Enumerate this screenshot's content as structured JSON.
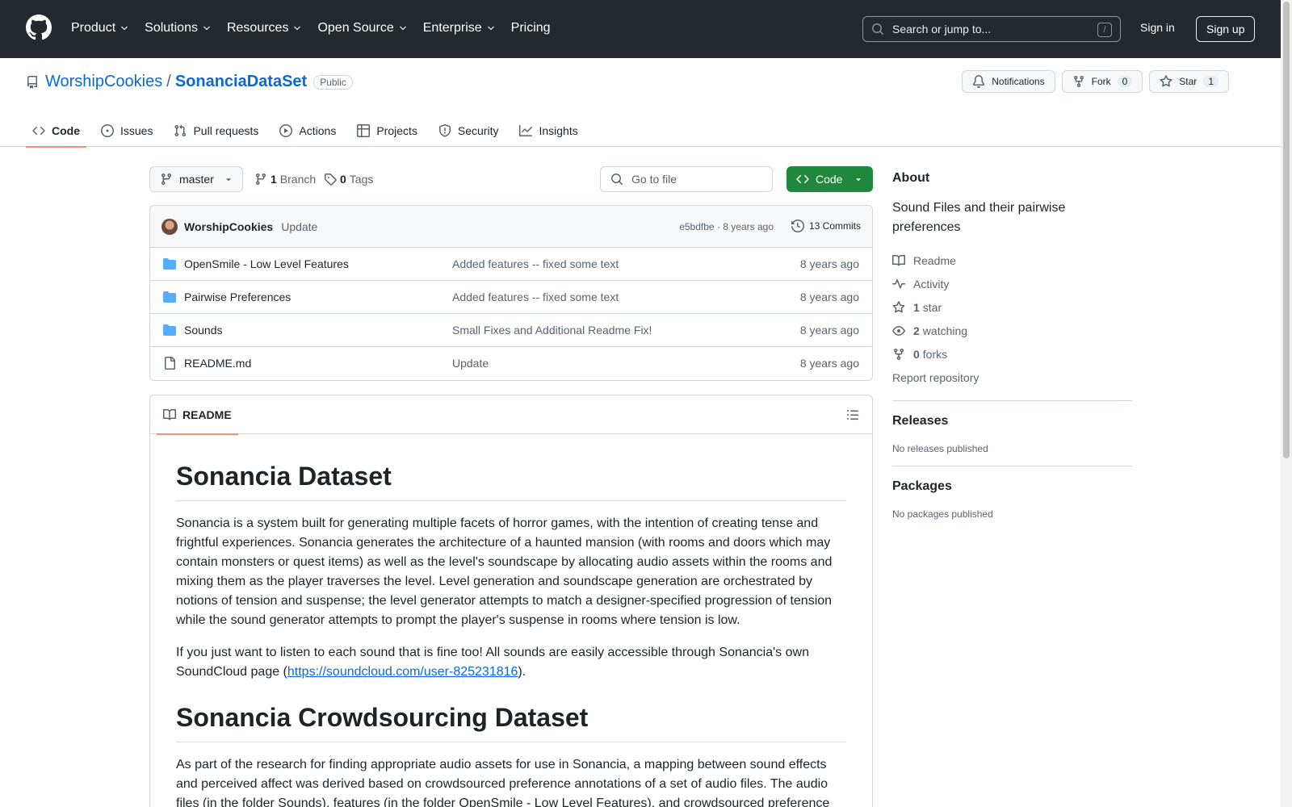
{
  "header": {
    "nav": [
      {
        "label": "Product",
        "has_menu": true
      },
      {
        "label": "Solutions",
        "has_menu": true
      },
      {
        "label": "Resources",
        "has_menu": true
      },
      {
        "label": "Open Source",
        "has_menu": true
      },
      {
        "label": "Enterprise",
        "has_menu": true
      },
      {
        "label": "Pricing",
        "has_menu": false
      }
    ],
    "search_placeholder": "Search or jump to...",
    "search_shortcut": "/",
    "sign_in": "Sign in",
    "sign_up": "Sign up"
  },
  "repo": {
    "owner": "WorshipCookies",
    "separator": "/",
    "name": "SonanciaDataSet",
    "visibility": "Public",
    "actions": {
      "notifications": "Notifications",
      "fork": "Fork",
      "fork_count": "0",
      "star": "Star",
      "star_count": "1"
    },
    "tabs": [
      {
        "label": "Code",
        "icon": "code-icon",
        "active": true
      },
      {
        "label": "Issues",
        "icon": "issue-icon",
        "active": false
      },
      {
        "label": "Pull requests",
        "icon": "pull-request-icon",
        "active": false
      },
      {
        "label": "Actions",
        "icon": "play-icon",
        "active": false
      },
      {
        "label": "Projects",
        "icon": "table-icon",
        "active": false
      },
      {
        "label": "Security",
        "icon": "shield-icon",
        "active": false
      },
      {
        "label": "Insights",
        "icon": "graph-icon",
        "active": false
      }
    ]
  },
  "toolbar": {
    "branch": "master",
    "branch_count": "1",
    "branch_label": "Branch",
    "tag_count": "0",
    "tag_label": "Tags",
    "goto_placeholder": "Go to file",
    "code_button": "Code"
  },
  "latest_commit": {
    "author": "WorshipCookies",
    "message": "Update",
    "sha": "e5bdfbe",
    "dot": "·",
    "age": "8 years ago",
    "commits": "13 Commits"
  },
  "files": [
    {
      "type": "folder",
      "name": "OpenSmile - Low Level Features",
      "message": "Added features -- fixed some text",
      "age": "8 years ago"
    },
    {
      "type": "folder",
      "name": "Pairwise Preferences",
      "message": "Added features -- fixed some text",
      "age": "8 years ago"
    },
    {
      "type": "folder",
      "name": "Sounds",
      "message": "Small Fixes and Additional Readme Fix!",
      "age": "8 years ago"
    },
    {
      "type": "file",
      "name": "README.md",
      "message": "Update",
      "age": "8 years ago"
    }
  ],
  "readme": {
    "tab_label": "README",
    "h1_1": "Sonancia Dataset",
    "p1": "Sonancia is a system built for generating multiple facets of horror games, with the intention of creating tense and frightful experiences. Sonancia generates the architecture of a haunted mansion (with rooms and doors which may contain monsters or quest items) as well as the level's soundscape by allocating audio assets within the rooms and mixing them as the player traverses the level. Level generation and soundscape generation are orchestrated by notions of tension and suspense; the level generator attempts to match a designer-specified progression of tension while the sound generator attempts to prompt the player's suspense in rooms where tension is low.",
    "p2_before": "If you just want to listen to each sound that is fine too! All sounds are easily accessible through Sonancia's own SoundCloud page (",
    "p2_link": "https://soundcloud.com/user-825231816",
    "p2_after": ").",
    "h1_2": "Sonancia Crowdsourcing Dataset",
    "p3": "As part of the research for finding appropriate audio assets for use in Sonancia, a mapping between sound effects and perceived affect was derived based on crowdsourced preference annotations of a set of audio files. The audio files (in the folder Sounds), features (in the folder OpenSmile - Low Level Features), and crowdsourced preference"
  },
  "sidebar": {
    "about_title": "About",
    "description": "Sound Files and their pairwise preferences",
    "readme": "Readme",
    "activity": "Activity",
    "stars_count": "1",
    "stars_label": "star",
    "watching_count": "2",
    "watching_label": "watching",
    "forks_count": "0",
    "forks_label": "forks",
    "report": "Report repository",
    "releases_title": "Releases",
    "releases_text": "No releases published",
    "packages_title": "Packages",
    "packages_text": "No packages published"
  },
  "colors": {
    "header_bg": "#24292f",
    "link": "#0969da",
    "primary_button": "#1f883d",
    "active_tab_underline": "#fd8c73",
    "folder_icon": "#54aeff"
  }
}
